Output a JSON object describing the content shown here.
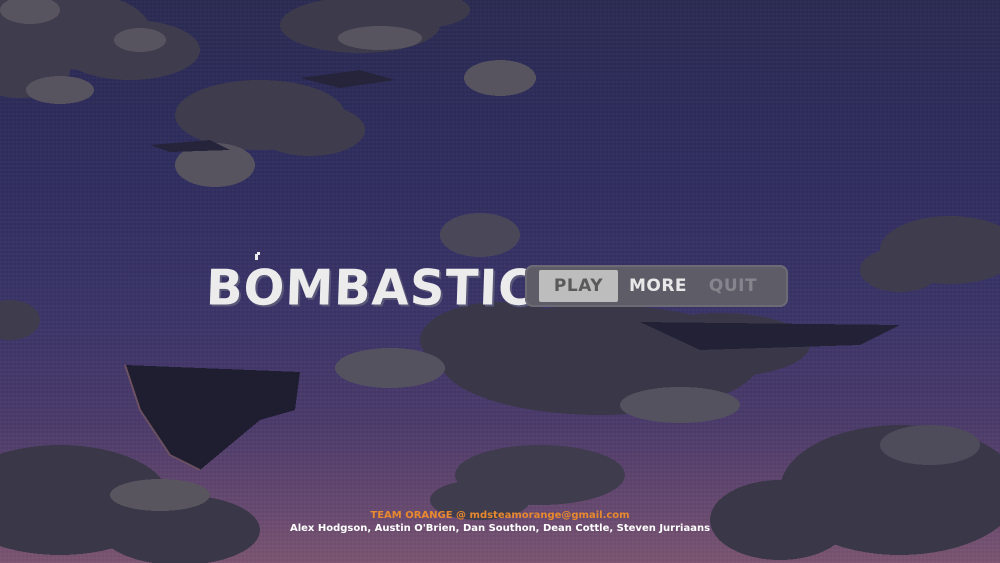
{
  "game": {
    "title": "BOMBASTIC"
  },
  "menu": {
    "items": [
      {
        "label": "PLAY",
        "state": "selected"
      },
      {
        "label": "MORE",
        "state": "normal"
      },
      {
        "label": "QUIT",
        "state": "disabled"
      }
    ]
  },
  "credits": {
    "team_line": "TEAM ORANGE @ mdsteamorange@gmail.com",
    "names_line": "Alex Hodgson, Austin O'Brien, Dan Southon, Dean Cottle, Steven Jurriaans"
  },
  "colors": {
    "sky_top": "#2a2a52",
    "sky_bottom": "#7a5470",
    "cloud_dark": "#3f3d4e",
    "cloud_mid": "#55525f",
    "cloud_light": "#6e6a78",
    "team_accent": "#e8892e",
    "menu_bg": "#5e5c66",
    "menu_selected": "#bdbdbd"
  }
}
